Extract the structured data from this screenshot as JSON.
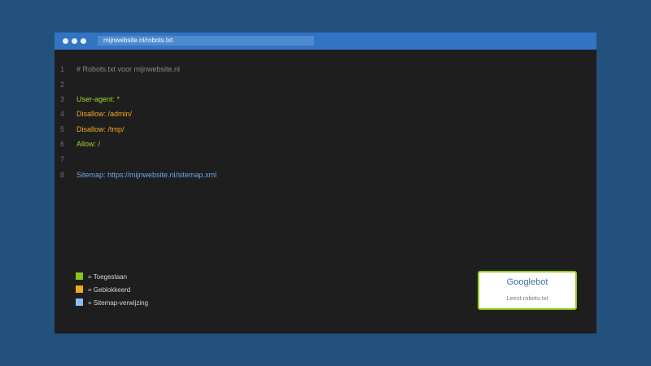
{
  "window": {
    "url": "mijnwebsite.nl/robots.txt"
  },
  "code": {
    "lines": [
      {
        "num": "1",
        "text": "# Robots.txt voor mijnwebsite.nl",
        "color": "#8a8a8a"
      },
      {
        "num": "2",
        "text": "",
        "color": "#8a8a8a"
      },
      {
        "num": "3",
        "text": "User-agent: *",
        "color": "#a6d22a"
      },
      {
        "num": "4",
        "text": "Disallow: /admin/",
        "color": "#f5a623"
      },
      {
        "num": "5",
        "text": "Disallow: /tmp/",
        "color": "#f5a623"
      },
      {
        "num": "6",
        "text": "Allow: /",
        "color": "#a6d22a"
      },
      {
        "num": "7",
        "text": "",
        "color": "#8a8a8a"
      },
      {
        "num": "8",
        "text": "Sitemap: https://mijnwebsite.nl/sitemap.xml",
        "color": "#6fa8e8"
      }
    ]
  },
  "legend": {
    "items": [
      {
        "label": "= Toegestaan",
        "color": "#8dc21f"
      },
      {
        "label": "= Geblokkeerd",
        "color": "#f5a623"
      },
      {
        "label": "= Sitemap-verwijzing",
        "color": "#8cc0f2"
      }
    ]
  },
  "bot_card": {
    "title": "Googlebot",
    "subtitle": "Leest robots.txt"
  }
}
